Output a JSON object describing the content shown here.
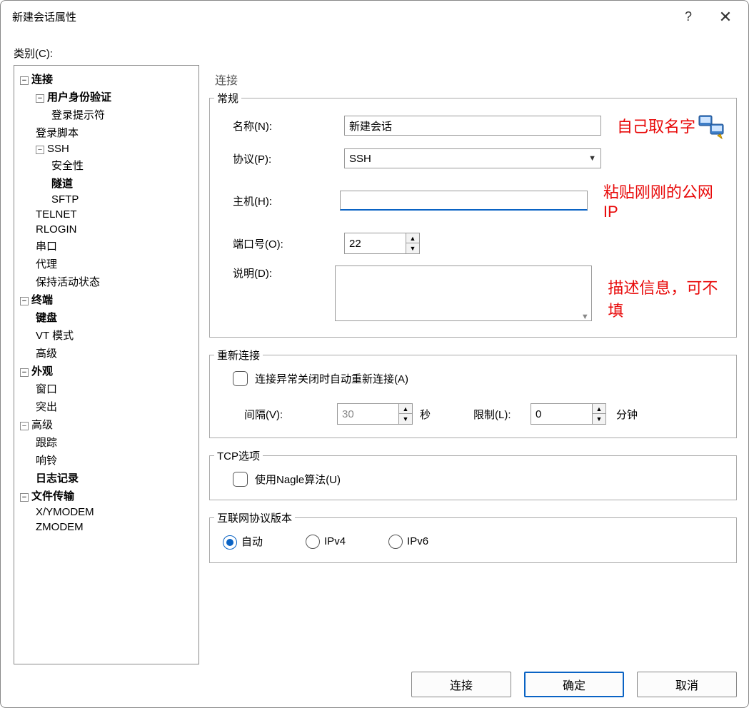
{
  "window": {
    "title": "新建会话属性",
    "help": "?",
    "close": "✕"
  },
  "category_label": "类别(C):",
  "tree": {
    "connection": "连接",
    "auth": "用户身份验证",
    "login_prompt": "登录提示符",
    "login_script": "登录脚本",
    "ssh": "SSH",
    "security": "安全性",
    "tunnel": "隧道",
    "sftp": "SFTP",
    "telnet": "TELNET",
    "rlogin": "RLOGIN",
    "serial": "串口",
    "proxy": "代理",
    "keepalive": "保持活动状态",
    "terminal": "终端",
    "keyboard": "键盘",
    "vt": "VT 模式",
    "advanced_t": "高级",
    "appearance": "外观",
    "window_i": "窗口",
    "highlight": "突出",
    "adv": "高级",
    "trace": "跟踪",
    "bell": "响铃",
    "log": "日志记录",
    "ft": "文件传输",
    "xym": "X/YMODEM",
    "zm": "ZMODEM"
  },
  "panel": {
    "header": "连接",
    "groups": {
      "general": "常规",
      "reconnect": "重新连接",
      "tcp": "TCP选项",
      "ipver": "互联网协议版本"
    },
    "labels": {
      "name": "名称(N):",
      "protocol": "协议(P):",
      "host": "主机(H):",
      "port": "端口号(O):",
      "desc": "说明(D):",
      "auto_reconnect": "连接异常关闭时自动重新连接(A)",
      "interval": "间隔(V):",
      "sec": "秒",
      "limit": "限制(L):",
      "min": "分钟",
      "nagle": "使用Nagle算法(U)",
      "auto": "自动",
      "ipv4": "IPv4",
      "ipv6": "IPv6"
    },
    "values": {
      "name": "新建会话",
      "protocol": "SSH",
      "host": "",
      "port": "22",
      "desc": "",
      "interval": "30",
      "limit": "0"
    },
    "annotations": {
      "name": "自己取名字",
      "host": "粘贴刚刚的公网IP",
      "desc": "描述信息，可不填"
    }
  },
  "footer": {
    "connect": "连接",
    "ok": "确定",
    "cancel": "取消"
  }
}
